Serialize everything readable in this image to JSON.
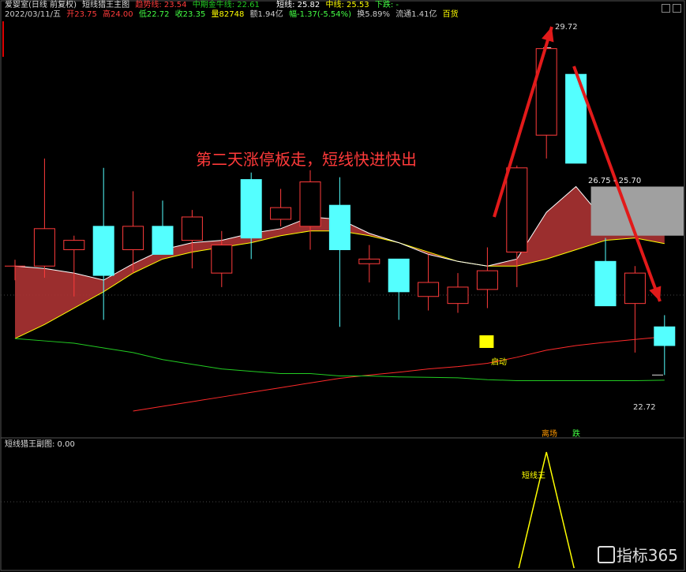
{
  "header": {
    "stock_name": "爱婴室(日线 前复权)",
    "main_indicator": "短线猎王主图",
    "trend_label": "趋势线: 23.54",
    "mid_bull_label": "中期金牛线: 22.61",
    "short_label": "短线: 25.82",
    "mid_label": "中线: 25.53",
    "down_label": "下跌: -",
    "date": "2022/03/11/五",
    "open": "开23.75",
    "high": "高24.00",
    "low": "低22.72",
    "close": "收23.35",
    "volume": "量82748",
    "amount": "额1.94亿",
    "change": "幅-1.37(-5.54%)",
    "turnover": "换5.89%",
    "float": "流通1.41亿",
    "sector": "百货"
  },
  "sub_panel": {
    "title": "短线猎王副图: 0.00",
    "peak_label": "短线王"
  },
  "annotations": {
    "headline": "第二天涨停板走，短线快进快出",
    "start_label": "启动",
    "high_label": "29.72",
    "low_label": "22.72",
    "zone_label": "26.75 - 25.70",
    "sell_label": "离场",
    "fall_label": "跌"
  },
  "watermark": "指标365",
  "colors": {
    "up": "#ff3b3b",
    "down": "#54ffff",
    "ribbon": "#a83232",
    "trend": "#ff2a2a",
    "mid_bull": "#22cc22",
    "white_line": "#ffffff",
    "yellow_line": "#ffff00",
    "signal": "#ffff00",
    "arrow": "#e21a1a",
    "zone": "#a0a0a0",
    "headline": "#ff3a3a"
  },
  "chart_data": {
    "type": "candlestick",
    "y_range": [
      22.0,
      30.2
    ],
    "candles": [
      {
        "o": 25.05,
        "h": 25.05,
        "l": 25.05,
        "c": 25.05
      },
      {
        "o": 25.05,
        "h": 27.35,
        "l": 24.8,
        "c": 25.85
      },
      {
        "o": 25.4,
        "h": 25.7,
        "l": 24.4,
        "c": 25.6
      },
      {
        "o": 25.9,
        "h": 27.15,
        "l": 23.9,
        "c": 24.85
      },
      {
        "o": 25.4,
        "h": 26.65,
        "l": 24.9,
        "c": 25.9
      },
      {
        "o": 25.9,
        "h": 26.45,
        "l": 25.3,
        "c": 25.3
      },
      {
        "o": 25.6,
        "h": 26.25,
        "l": 25.0,
        "c": 26.1
      },
      {
        "o": 24.9,
        "h": 25.8,
        "l": 24.6,
        "c": 25.5
      },
      {
        "o": 26.9,
        "h": 27.05,
        "l": 25.2,
        "c": 25.65
      },
      {
        "o": 26.05,
        "h": 26.7,
        "l": 25.9,
        "c": 26.3
      },
      {
        "o": 25.9,
        "h": 27.1,
        "l": 25.4,
        "c": 26.85
      },
      {
        "o": 26.35,
        "h": 26.95,
        "l": 23.75,
        "c": 25.4
      },
      {
        "o": 25.1,
        "h": 25.5,
        "l": 24.7,
        "c": 25.2
      },
      {
        "o": 25.2,
        "h": 25.2,
        "l": 23.9,
        "c": 24.5
      },
      {
        "o": 24.4,
        "h": 25.3,
        "l": 24.1,
        "c": 24.7
      },
      {
        "o": 24.25,
        "h": 24.9,
        "l": 24.05,
        "c": 24.6
      },
      {
        "o": 24.55,
        "h": 25.45,
        "l": 24.15,
        "c": 24.95
      },
      {
        "o": 25.35,
        "h": 27.2,
        "l": 24.6,
        "c": 27.15
      },
      {
        "o": 27.85,
        "h": 29.72,
        "l": 27.35,
        "c": 29.7
      },
      {
        "o": 29.15,
        "h": 29.15,
        "l": 27.25,
        "c": 27.25
      },
      {
        "o": 25.15,
        "h": 25.65,
        "l": 24.2,
        "c": 24.2
      },
      {
        "o": 24.25,
        "h": 25.05,
        "l": 23.2,
        "c": 24.9
      },
      {
        "o": 23.75,
        "h": 24.0,
        "l": 22.72,
        "c": 23.35
      }
    ],
    "short_line": [
      25.05,
      25.0,
      24.9,
      24.75,
      25.1,
      25.4,
      25.55,
      25.6,
      25.75,
      25.85,
      26.1,
      26.05,
      25.75,
      25.55,
      25.3,
      25.15,
      25.05,
      25.2,
      26.2,
      26.75,
      26.0,
      25.9,
      25.82
    ],
    "mid_line": [
      23.5,
      23.8,
      24.15,
      24.5,
      24.9,
      25.2,
      25.35,
      25.45,
      25.55,
      25.7,
      25.8,
      25.8,
      25.7,
      25.55,
      25.35,
      25.15,
      25.05,
      25.05,
      25.2,
      25.4,
      25.6,
      25.65,
      25.53
    ],
    "trend_line": [
      null,
      null,
      null,
      null,
      21.95,
      22.05,
      22.15,
      22.25,
      22.35,
      22.45,
      22.55,
      22.65,
      22.72,
      22.78,
      22.85,
      22.9,
      22.97,
      23.1,
      23.25,
      23.35,
      23.42,
      23.48,
      23.54
    ],
    "mid_bull_line": [
      23.5,
      23.45,
      23.4,
      23.3,
      23.2,
      23.05,
      22.95,
      22.85,
      22.8,
      22.75,
      22.75,
      22.7,
      22.7,
      22.68,
      22.67,
      22.66,
      22.62,
      22.6,
      22.6,
      22.6,
      22.6,
      22.6,
      22.61
    ],
    "signal_index": 16,
    "zone": [
      25.7,
      26.75
    ],
    "sub_panel_spike_index": 18
  }
}
